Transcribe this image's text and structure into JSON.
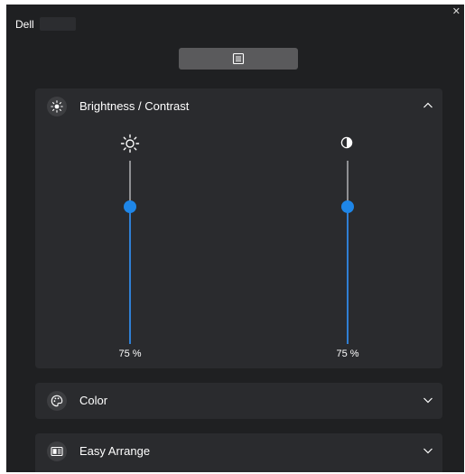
{
  "app": {
    "title": "Dell"
  },
  "sections": {
    "brightness_contrast": {
      "title": "Brightness / Contrast",
      "brightness": {
        "value": 75,
        "label": "75 %"
      },
      "contrast": {
        "value": 75,
        "label": "75 %"
      }
    },
    "color": {
      "title": "Color"
    },
    "easy_arrange": {
      "title": "Easy Arrange"
    }
  },
  "colors": {
    "accent": "#1e86e8",
    "background": "#1f2022",
    "panel": "#2a2b2e"
  }
}
